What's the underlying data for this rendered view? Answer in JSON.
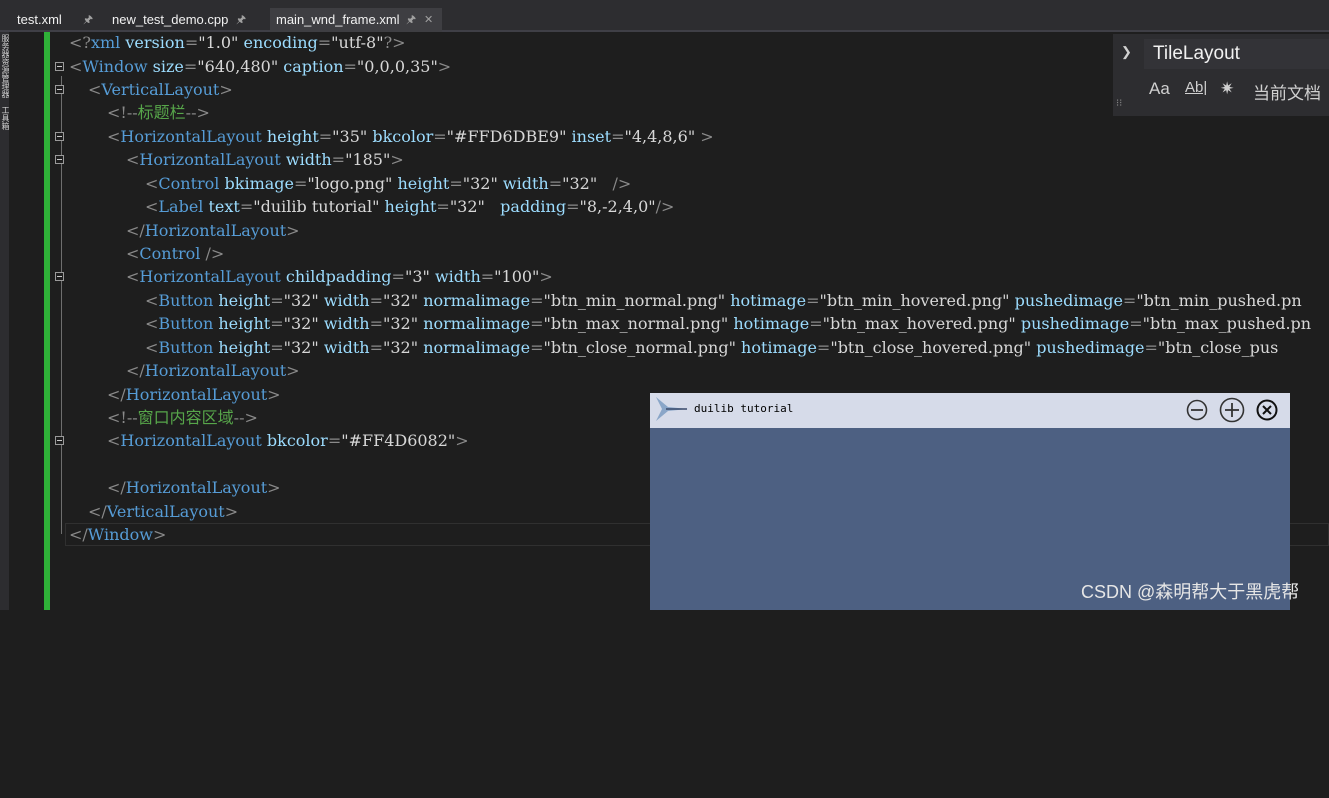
{
  "tabs": [
    {
      "label": "test.xml",
      "pin": "🖈",
      "active": false
    },
    {
      "label": "new_test_demo.cpp",
      "pin": "🖈",
      "active": false
    },
    {
      "label": "main_wnd_frame.xml",
      "pin": "🖈",
      "close": "✕",
      "active": true
    }
  ],
  "left_strip": {
    "labels": [
      "服务器资源管理器",
      "工具箱"
    ]
  },
  "code": {
    "l1": {
      "open": "<?",
      "tag": "xml",
      "a1": "version",
      "v1": "\"1.0\"",
      "a2": "encoding",
      "v2": "\"utf-8\"",
      "close": "?>"
    },
    "l2": {
      "tag": "Window",
      "a1": "size",
      "v1": "\"640,480\"",
      "a2": "caption",
      "v2": "\"0,0,0,35\""
    },
    "l3": {
      "tag": "VerticalLayout"
    },
    "l4": {
      "comment": "标题栏"
    },
    "l5": {
      "tag": "HorizontalLayout",
      "a1": "height",
      "v1": "\"35\"",
      "a2": "bkcolor",
      "v2": "\"#FFD6DBE9\"",
      "a3": "inset",
      "v3": "\"4,4,8,6\""
    },
    "l6": {
      "tag": "HorizontalLayout",
      "a1": "width",
      "v1": "\"185\""
    },
    "l7": {
      "tag": "Control",
      "a1": "bkimage",
      "v1": "\"logo.png\"",
      "a2": "height",
      "v2": "\"32\"",
      "a3": "width",
      "v3": "\"32\""
    },
    "l8": {
      "tag": "Label",
      "a1": "text",
      "v1": "\"duilib tutorial\"",
      "a2": "height",
      "v2": "\"32\"",
      "a3": "padding",
      "v3": "\"8,-2,4,0\""
    },
    "l9": {
      "tag": "HorizontalLayout"
    },
    "l10": {
      "tag": "Control"
    },
    "l11": {
      "tag": "HorizontalLayout",
      "a1": "childpadding",
      "v1": "\"3\"",
      "a2": "width",
      "v2": "\"100\""
    },
    "l12": {
      "tag": "Button",
      "a1": "height",
      "v1": "\"32\"",
      "a2": "width",
      "v2": "\"32\"",
      "a3": "normalimage",
      "v3": "\"btn_min_normal.png\"",
      "a4": "hotimage",
      "v4": "\"btn_min_hovered.png\"",
      "a5": "pushedimage",
      "v5": "\"btn_min_pushed.pn"
    },
    "l13": {
      "tag": "Button",
      "a1": "height",
      "v1": "\"32\"",
      "a2": "width",
      "v2": "\"32\"",
      "a3": "normalimage",
      "v3": "\"btn_max_normal.png\"",
      "a4": "hotimage",
      "v4": "\"btn_max_hovered.png\"",
      "a5": "pushedimage",
      "v5": "\"btn_max_pushed.pn"
    },
    "l14": {
      "tag": "Button",
      "a1": "height",
      "v1": "\"32\"",
      "a2": "width",
      "v2": "\"32\"",
      "a3": "normalimage",
      "v3": "\"btn_close_normal.png\"",
      "a4": "hotimage",
      "v4": "\"btn_close_hovered.png\"",
      "a5": "pushedimage",
      "v5": "\"btn_close_pus"
    },
    "l15": {
      "tag": "HorizontalLayout"
    },
    "l16": {
      "tag": "HorizontalLayout"
    },
    "l17": {
      "comment": "窗口内容区域"
    },
    "l18": {
      "tag": "HorizontalLayout",
      "a1": "bkcolor",
      "v1": "\"#FF4D6082\""
    },
    "l20": {
      "tag": "HorizontalLayout"
    },
    "l21": {
      "tag": "VerticalLayout"
    },
    "l22": {
      "tag": "Window"
    }
  },
  "find": {
    "value": "TileLayout",
    "match_case_icon": "Aa",
    "whole_word_icon": "Ab|",
    "regex_icon": "regex-icon",
    "scope_label": "当前文档"
  },
  "preview": {
    "title": "duilib tutorial",
    "bkcolor": "#4d6082",
    "title_bkcolor": "#d6dbe9"
  },
  "watermark": "CSDN @森明帮大于黑虎帮"
}
